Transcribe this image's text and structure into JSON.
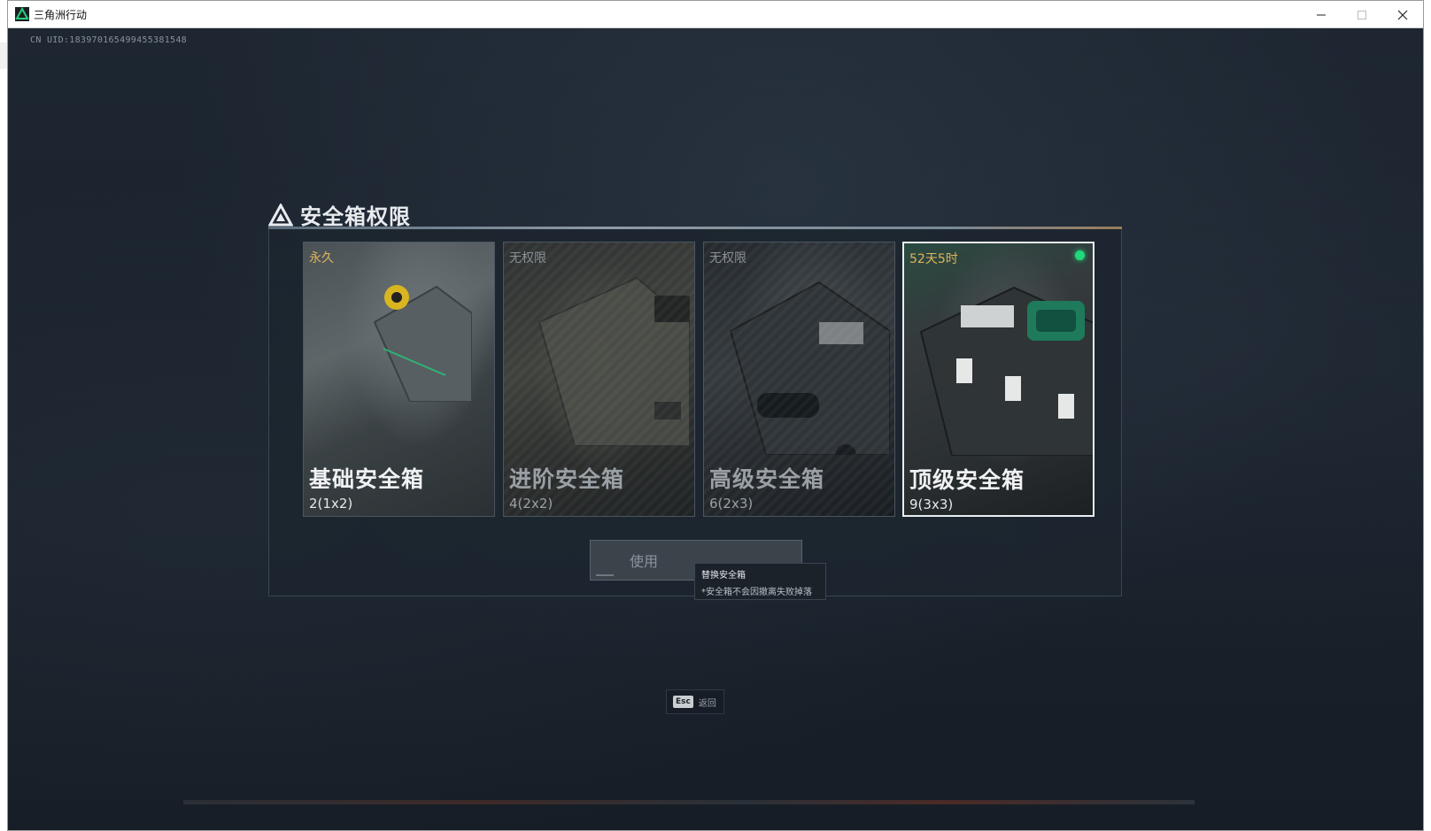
{
  "window": {
    "title": "三角洲行动",
    "controls": {
      "minimize": "–",
      "maximize": "☐",
      "close": "✕"
    }
  },
  "uid": "CN UID:1839701654994553815​48",
  "panel": {
    "title": "安全箱权限",
    "cards": [
      {
        "status": "永久",
        "name": "基础安全箱",
        "size": "2(1x2)",
        "locked": false,
        "selected": false,
        "status_color": "#e0b458"
      },
      {
        "status": "无权限",
        "name": "进阶安全箱",
        "size": "4(2x2)",
        "locked": true,
        "selected": false,
        "status_color": "#8a9096"
      },
      {
        "status": "无权限",
        "name": "高级安全箱",
        "size": "6(2x3)",
        "locked": true,
        "selected": false,
        "status_color": "#8a9096"
      },
      {
        "status": "52天5时",
        "name": "顶级安全箱",
        "size": "9(3x3)",
        "locked": false,
        "selected": true,
        "status_color": "#e0b458",
        "active_indicator": "green-dot"
      }
    ],
    "use_button": {
      "label": "使用"
    },
    "tooltip": {
      "title": "替换安全箱",
      "desc": "*安全箱不会因撤离失败掉落"
    }
  },
  "footer": {
    "esc_key": "Esc",
    "esc_label": "返回"
  },
  "colors": {
    "accent_gold": "#e0b458",
    "active_green": "#1fd87a",
    "panel_bg": "#1c252f"
  }
}
